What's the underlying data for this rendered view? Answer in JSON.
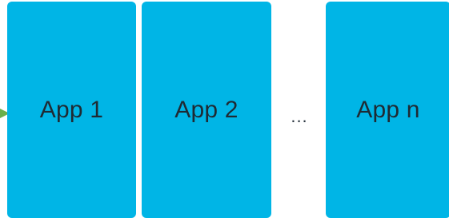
{
  "diagram": {
    "apps": [
      {
        "label": "App 1"
      },
      {
        "label": "App 2"
      },
      {
        "label": "App n"
      }
    ],
    "ellipsis": "...",
    "colors": {
      "box_fill": "#00B5E6",
      "arrow": "#6AB04C",
      "text": "#1F2A33"
    },
    "icons": {
      "entry_arrow": "arrow-right-icon"
    }
  }
}
